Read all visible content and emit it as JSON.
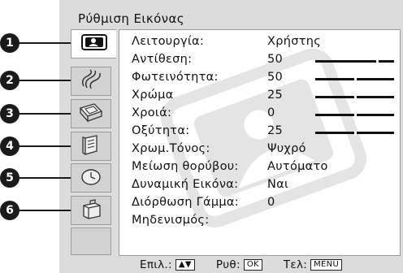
{
  "title": "Ρύθμιση Εικόνας",
  "tabs": [
    {
      "number": "1",
      "icon": "picture-icon"
    },
    {
      "number": "2",
      "icon": "sound-icon"
    },
    {
      "number": "3",
      "icon": "screen-icon"
    },
    {
      "number": "4",
      "icon": "features-icon"
    },
    {
      "number": "5",
      "icon": "timer-icon"
    },
    {
      "number": "6",
      "icon": "setup-icon"
    },
    {
      "number": "",
      "icon": ""
    }
  ],
  "settings": [
    {
      "label": "Λειτουργία:",
      "value": "Χρήστης"
    },
    {
      "label": "Αντίθεση:",
      "value": "50",
      "level": 0.78
    },
    {
      "label": "Φωτεινότητα:",
      "value": "50",
      "level": 0.5
    },
    {
      "label": "Χρώμα",
      "value": "25",
      "level": 0.5
    },
    {
      "label": "Χροιά:",
      "value": "0",
      "level": 0.5
    },
    {
      "label": "Οξύτητα:",
      "value": "25",
      "level": 0.5
    },
    {
      "label": "Χρωμ.Τόνος:",
      "value": "Ψυχρό"
    },
    {
      "label": "Μείωση θορύβου:",
      "value": "Αυτόματο"
    },
    {
      "label": "Δυναμική Εικόνα:",
      "value": "Ναι"
    },
    {
      "label": "Διόρθωση Γάμμα:",
      "value": "0"
    },
    {
      "label": "Μηδενισμός:",
      "value": ""
    }
  ],
  "footer": {
    "select_label": "Επιλ.:",
    "select_keys": "▲▼",
    "adjust_label": "Ρυθ:",
    "adjust_key": "OK",
    "exit_label": "Τελ:",
    "exit_key": "MENU"
  }
}
